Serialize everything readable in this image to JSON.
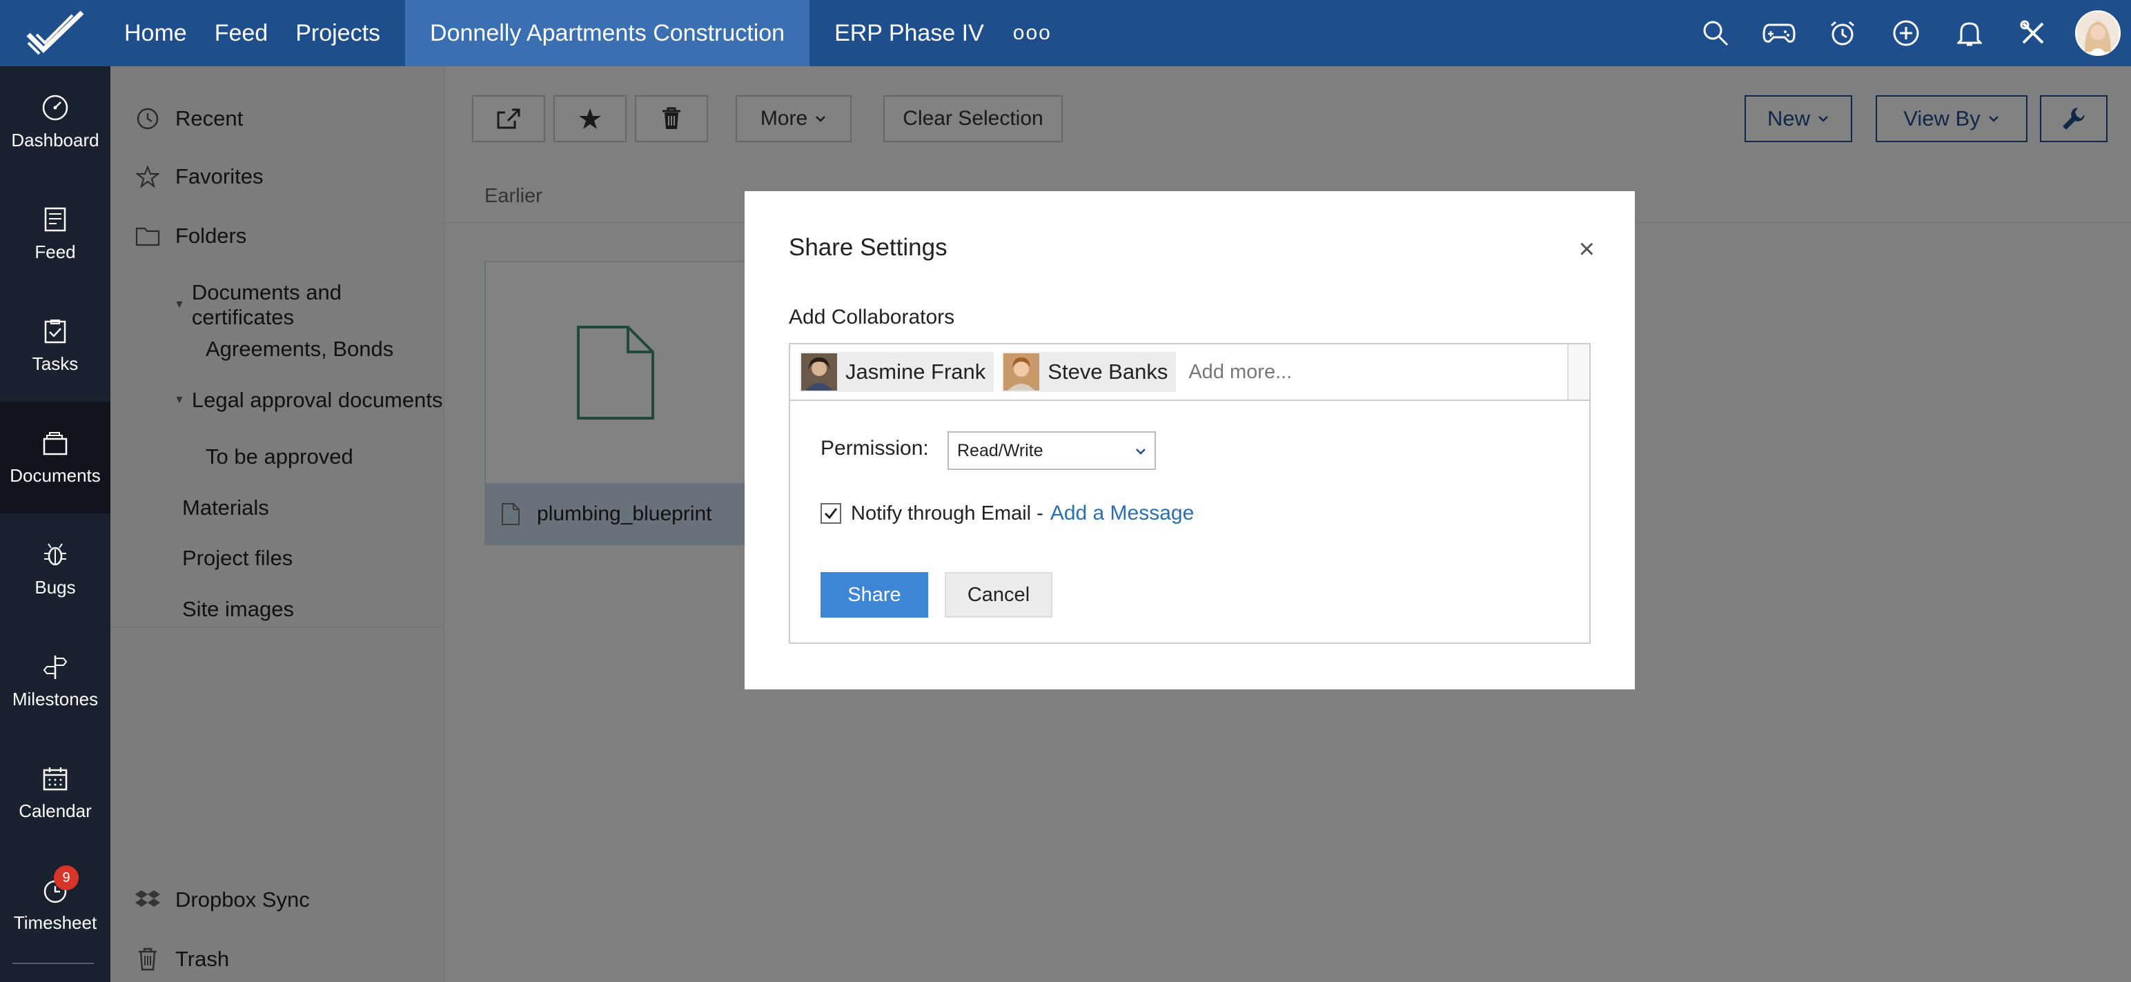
{
  "topbar": {
    "nav": [
      "Home",
      "Feed",
      "Projects"
    ],
    "active_project": "Donnelly Apartments Construction",
    "other_project": "ERP Phase IV",
    "more_dots": "ooo",
    "icons": [
      "search-icon",
      "game-controller-icon",
      "alarm-clock-icon",
      "add-circle-icon",
      "bell-icon",
      "tools-icon"
    ],
    "brand_color": "#1e4f8c",
    "active_tab_color": "#3a70b2"
  },
  "rail": {
    "items": [
      {
        "label": "Dashboard",
        "icon": "dashboard-icon"
      },
      {
        "label": "Feed",
        "icon": "feed-icon"
      },
      {
        "label": "Tasks",
        "icon": "tasks-icon"
      },
      {
        "label": "Documents",
        "icon": "documents-icon",
        "active": true
      },
      {
        "label": "Bugs",
        "icon": "bug-icon"
      },
      {
        "label": "Milestones",
        "icon": "milestone-icon"
      },
      {
        "label": "Calendar",
        "icon": "calendar-icon"
      },
      {
        "label": "Timesheet",
        "icon": "timesheet-icon",
        "badge": "9"
      }
    ]
  },
  "folders": {
    "recent": "Recent",
    "favorites": "Favorites",
    "folders": "Folders",
    "docs_certs": "Documents and certificates",
    "agreements": "Agreements, Bonds",
    "legal": "Legal approval documents",
    "to_be_approved": "To be approved",
    "materials": "Materials",
    "project_files": "Project files",
    "site_images": "Site images",
    "dropbox": "Dropbox Sync",
    "trash": "Trash"
  },
  "toolbar": {
    "more": "More",
    "clear_selection": "Clear Selection",
    "new": "New",
    "view_by": "View By"
  },
  "main": {
    "section": "Earlier",
    "file_name": "plumbing_blueprint"
  },
  "modal": {
    "title": "Share Settings",
    "close": "×",
    "add_collaborators": "Add Collaborators",
    "collaborators": [
      "Jasmine Frank",
      "Steve Banks"
    ],
    "add_more_placeholder": "Add more...",
    "permission_label": "Permission:",
    "permission_value": "Read/Write",
    "notify_text": "Notify through Email -",
    "add_message": "Add a Message",
    "notify_checked": true,
    "share": "Share",
    "cancel": "Cancel",
    "share_color": "#3d86d6"
  }
}
